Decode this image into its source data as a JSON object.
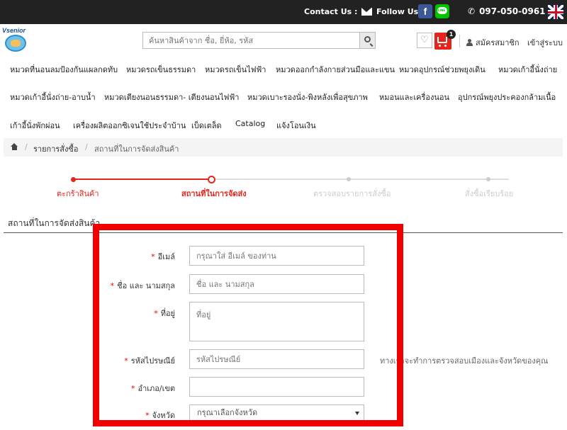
{
  "topbar": {
    "contact_label": "Contact Us :",
    "follow_label": "Follow Us :",
    "facebook_glyph": "f",
    "phone": "097-050-0961"
  },
  "header": {
    "logo_text": "Vsenior",
    "search_placeholder": "ค้นหาสินค้าจาก ชื่อ, ยี่ห้อ, รหัส",
    "cart_count": "1",
    "register_label": "สมัครสมาชิก",
    "login_label": "เข้าสู่ระบบ"
  },
  "nav": {
    "row1": [
      "หมวดที่นอนลมป้องกันแผลกดทับ",
      "หมวดรถเข็นธรรมดา",
      "หมวดรถเข็นไฟฟ้า",
      "หมวดออกกำลังกายส่วนมือและแขน",
      "หมวดอุปกรณ์ช่วยพยุงเดิน",
      "หมวดเก้าอี้นั่งถ่าย"
    ],
    "row2": [
      "หมวดเก้าอี้นั่งถ่าย-อาบน้ำ",
      "หมวดเตียงนอนธรรมดา- เตียงนอนไฟฟ้า",
      "หมวดเบาะรองนั่ง-พิงหลังเพื่อสุขภาพ",
      "หมอนและเครื่องนอน",
      "อุปกรณ์พยุงประคองกล้ามเนื้อ"
    ],
    "row3": [
      "เก้าอี้นั่งพักผ่อน",
      "เครื่องผลิตออกซิเจนใช้ประจำบ้าน",
      "เบ็ดเตล็ด",
      "Catalog",
      "แจ้งโอนเงิน"
    ]
  },
  "breadcrumb": {
    "sep": "/",
    "items": [
      "รายการสั่งซื้อ",
      "สถานที่ในการจัดส่งสินค้า"
    ]
  },
  "steps": {
    "items": [
      {
        "label": "ตะกร้าสินค้า",
        "state": "done"
      },
      {
        "label": "สถานที่ในการจัดส่ง",
        "state": "current"
      },
      {
        "label": "ตรวจสอบรายการสั่งซื้อ",
        "state": "pending"
      },
      {
        "label": "สั่งซื้อเรียบร้อย",
        "state": "pending"
      }
    ],
    "active_color": "#e5241c",
    "inactive_color": "#cccccc"
  },
  "section": {
    "title": "สถานที่ในการจัดส่งสินค้า"
  },
  "form": {
    "required_mark": "*",
    "email_label": "อีเมล์",
    "email_placeholder": "กรุณาใส่ อีเมล์ ของท่าน",
    "name_label": "ชื่อ และ นามสกุล",
    "name_placeholder": "ชื่อ และ นามสกุล",
    "address_label": "ที่อยู่",
    "address_placeholder": "ที่อยู่",
    "postcode_label": "รหัสไปรษณีย์",
    "postcode_placeholder": "รหัสไปรษณีย์",
    "postcode_hint": "ทางเราจะทำการตรวจสอบเมืองและจังหวัดของคุณ",
    "district_label": "อำเภอ/เขต",
    "district_value": "",
    "province_label": "จังหวัด",
    "province_selected": "กรุณาเลือกจังหวัด"
  },
  "colors": {
    "highlight": "#f20000",
    "topbar": "#222222",
    "accent": "#e5241c"
  }
}
